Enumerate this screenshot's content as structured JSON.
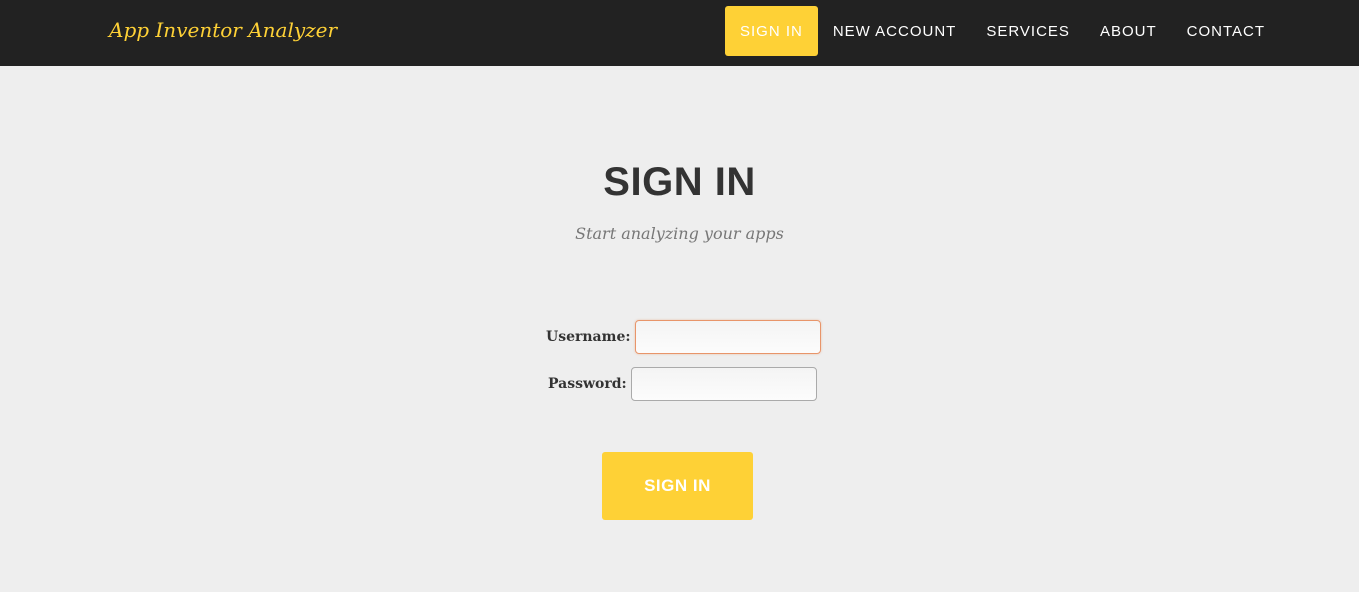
{
  "navbar": {
    "brand": "App Inventor Analyzer",
    "items": [
      {
        "label": "SIGN IN",
        "active": true
      },
      {
        "label": "NEW ACCOUNT",
        "active": false
      },
      {
        "label": "SERVICES",
        "active": false
      },
      {
        "label": "ABOUT",
        "active": false
      },
      {
        "label": "CONTACT",
        "active": false
      }
    ]
  },
  "main": {
    "title": "SIGN IN",
    "subtitle": "Start analyzing your apps"
  },
  "form": {
    "username_label": "Username:",
    "username_value": "",
    "password_label": "Password:",
    "password_value": "",
    "submit_label": "SIGN IN"
  },
  "colors": {
    "accent": "#fed136",
    "navbar_bg": "#222222",
    "page_bg": "#eeeeee",
    "heading": "#333333",
    "focus_border": "#e8956a"
  }
}
